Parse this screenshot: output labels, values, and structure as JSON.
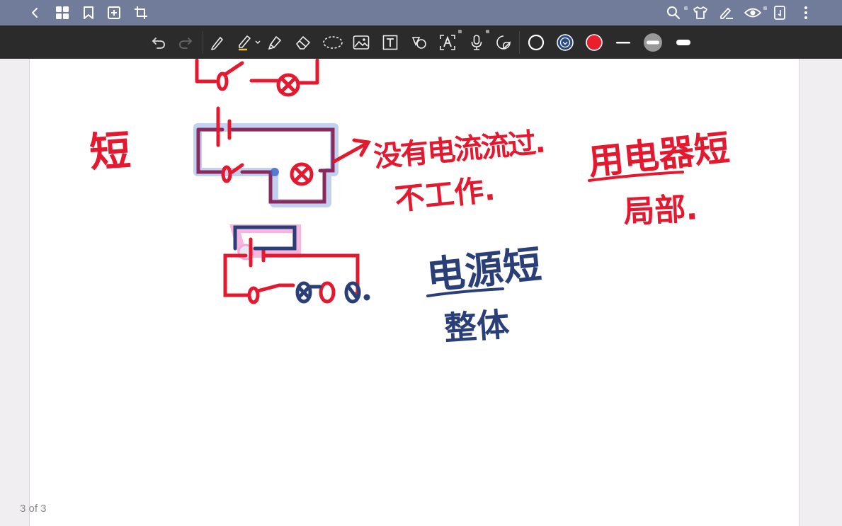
{
  "topbar": {
    "left_icons": [
      "back-icon",
      "grid-icon",
      "bookmark-icon",
      "add-page-icon",
      "crop-icon"
    ],
    "right_icons": [
      "search-icon",
      "shirt-icon",
      "pen-edit-icon",
      "eye-icon",
      "document-icon",
      "more-icon"
    ]
  },
  "toolbar": {
    "tools": [
      "undo-icon",
      "redo-icon",
      "pen-icon",
      "highlighter-icon",
      "marker-icon",
      "eraser-icon",
      "lasso-icon",
      "image-icon",
      "text-icon",
      "shape-icon",
      "ocr-text-icon",
      "microphone-icon",
      "sticker-icon"
    ],
    "colors": [
      "#ffffff",
      "#2a4a85",
      "#e8202e"
    ],
    "strokes": [
      "thin",
      "medium",
      "thick"
    ]
  },
  "page_indicator": "3 of 3",
  "annotations": {
    "short": "短",
    "no_current": "没有电流流过.",
    "not_work": "不工作.",
    "appliance_short": "用电器短",
    "partial": "局部.",
    "power_short": "电源短",
    "whole": "整体"
  }
}
